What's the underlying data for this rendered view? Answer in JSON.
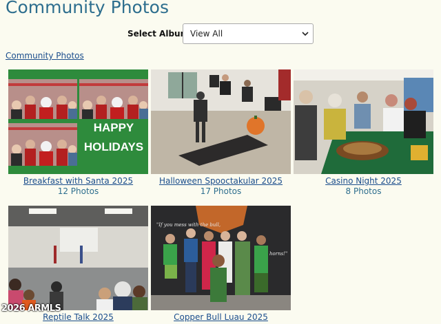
{
  "page": {
    "title": "Community Photos"
  },
  "album_filter": {
    "label": "Select Album:",
    "selected": "View All"
  },
  "breadcrumb": {
    "label": "Community Photos"
  },
  "albums": [
    {
      "title": "Breakfast with Santa 2025",
      "count": "12 Photos",
      "overlay_line1": "HAPPY",
      "overlay_line2": "HOLIDAYS"
    },
    {
      "title": "Halloween Spooctakular 2025",
      "count": "17 Photos"
    },
    {
      "title": "Casino Night 2025",
      "count": "8 Photos"
    },
    {
      "title": "Reptile Talk 2025",
      "count": ""
    },
    {
      "title": "Copper Bull Luau 2025",
      "count": "",
      "sign_text_left": "\"If you mess with the bull,",
      "sign_text_right": "horns!\""
    }
  ],
  "watermark": "2026 ARMLS"
}
